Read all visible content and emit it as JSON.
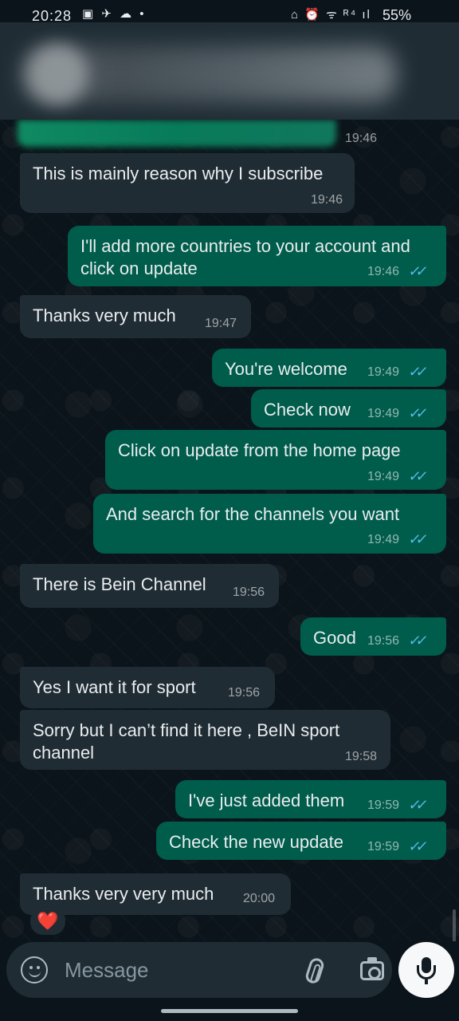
{
  "status_bar": {
    "time": "20:28",
    "left_icons": "▣ ✈ ☁ •",
    "right_icons": "⌂ ⏰ ᯤ ᴿ⁴ ıl",
    "battery": "55%"
  },
  "chat": {
    "messages": [
      {
        "direction": "incoming",
        "text": "",
        "time": "19:46",
        "read": false
      },
      {
        "direction": "incoming",
        "text": "This is mainly reason why I subscribe",
        "time": "19:46",
        "read": false
      },
      {
        "direction": "outgoing",
        "text": "I'll add more countries to your account and click on update",
        "time": "19:46",
        "read": true
      },
      {
        "direction": "incoming",
        "text": "Thanks very much",
        "time": "19:47",
        "read": false
      },
      {
        "direction": "outgoing",
        "text": "You're welcome",
        "time": "19:49",
        "read": true
      },
      {
        "direction": "outgoing",
        "text": "Check now",
        "time": "19:49",
        "read": true
      },
      {
        "direction": "outgoing",
        "text": "Click on update from the home page",
        "time": "19:49",
        "read": true
      },
      {
        "direction": "outgoing",
        "text": "And search for the channels you want",
        "time": "19:49",
        "read": true
      },
      {
        "direction": "incoming",
        "text": "There is Bein Channel",
        "time": "19:56",
        "read": false
      },
      {
        "direction": "outgoing",
        "text": "Good",
        "time": "19:56",
        "read": true
      },
      {
        "direction": "incoming",
        "text": "Yes I want it for sport",
        "time": "19:56",
        "read": false
      },
      {
        "direction": "incoming",
        "text": "Sorry but I can’t find it here , BeIN sport channel",
        "time": "19:58",
        "read": false
      },
      {
        "direction": "outgoing",
        "text": "I've just added them",
        "time": "19:59",
        "read": true
      },
      {
        "direction": "outgoing",
        "text": "Check the new update",
        "time": "19:59",
        "read": true
      },
      {
        "direction": "incoming",
        "text": "Thanks very very much",
        "time": "20:00",
        "read": false,
        "reaction": "❤️"
      }
    ],
    "read_receipt_icon": "double-check-icon",
    "colors": {
      "background": "#0b141a",
      "incoming": "#202c33",
      "outgoing": "#005c4b",
      "read_receipt": "#53bdeb"
    }
  },
  "composer": {
    "placeholder": "Message",
    "icons": [
      "sticker-icon",
      "paperclip-icon",
      "camera-icon",
      "microphone-icon"
    ]
  }
}
